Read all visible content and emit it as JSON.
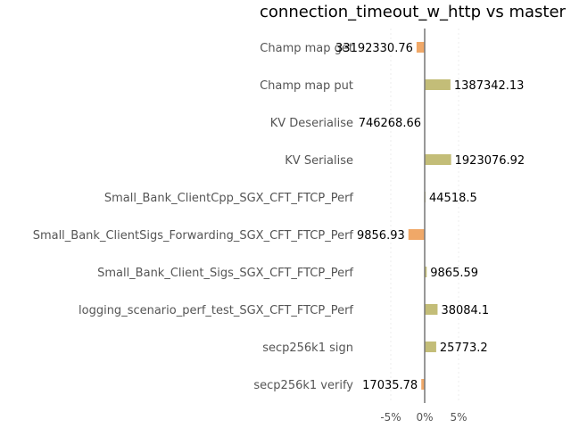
{
  "chart_data": {
    "type": "bar",
    "orientation": "horizontal",
    "title": "connection_timeout_w_http vs master",
    "xlabel": "",
    "ylabel": "",
    "categories": [
      "Champ map get",
      "Champ map put",
      "KV Deserialise",
      "KV Serialise",
      "Small_Bank_ClientCpp_SGX_CFT_FTCP_Perf",
      "Small_Bank_ClientSigs_Forwarding_SGX_CFT_FTCP_Perf",
      "Small_Bank_Client_Sigs_SGX_CFT_FTCP_Perf",
      "logging_scenario_perf_test_SGX_CFT_FTCP_Perf",
      "secp256k1 sign",
      "secp256k1 verify"
    ],
    "values": [
      -1.2,
      3.8,
      0.0,
      3.9,
      0.05,
      -2.4,
      0.3,
      1.9,
      1.7,
      -0.5
    ],
    "value_labels": [
      "33192330.76",
      "1387342.13",
      "746268.66",
      "1923076.92",
      "44518.5",
      "9856.93",
      "9865.59",
      "38084.1",
      "25773.2",
      "17035.78"
    ],
    "xlim": [
      -10,
      10
    ],
    "xticks": [
      -5,
      0,
      5
    ],
    "xtick_labels": [
      "-5%",
      "0%",
      "5%"
    ],
    "grid": true,
    "colors": {
      "positive": "#c3bd78",
      "negative": "#f0a868",
      "zero_line": "#777777",
      "grid": "#eeeeee"
    }
  }
}
